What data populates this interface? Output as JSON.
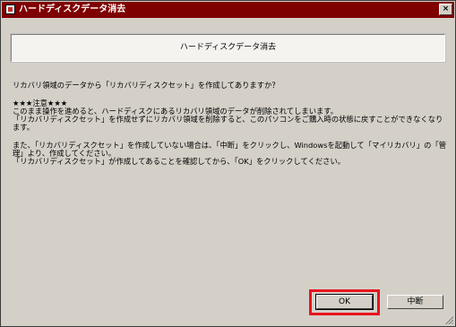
{
  "window": {
    "title": "ハードディスクデータ消去",
    "close_label": "×"
  },
  "banner": {
    "text": "ハードディスクデータ消去"
  },
  "body": {
    "question": "リカバリ領域のデータから「リカバリディスクセット」を作成してありますか？",
    "warning_heading": "★★★注意★★★",
    "warning_line1": "このまま操作を進めると、ハードディスクにあるリカバリ領域のデータが削除されてしまいます。",
    "warning_line2": "「リカバリディスクセット」を作成せずにリカバリ領域を削除すると、このパソコンをご購入時の状態に戻すことができなくなります。",
    "info_line1": "また、「リカバリディスクセット」を作成していない場合は、「中断」をクリックし、Windowsを起動して「マイリカバリ」の「管理」より、作成してください。",
    "info_line2": "「リカバリディスクセット」が作成してあることを確認してから、「OK」をクリックしてください。"
  },
  "buttons": {
    "ok_label": "OK",
    "cancel_label": "中断"
  },
  "colors": {
    "titlebar": "#7f0000",
    "highlight": "#e8141e",
    "window_bg": "#d4d0c8"
  }
}
